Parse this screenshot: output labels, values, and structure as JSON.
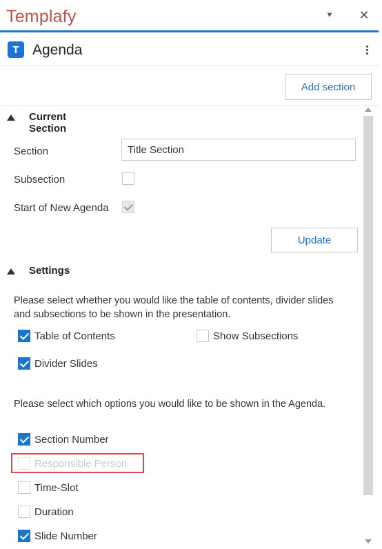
{
  "app": {
    "title": "Templafy"
  },
  "header": {
    "logo_letter": "T",
    "title": "Agenda"
  },
  "toolbar": {
    "add_section_label": "Add section"
  },
  "current_section": {
    "heading": "Current Section",
    "section_label": "Section",
    "section_value": "Title Section",
    "subsection_label": "Subsection",
    "subsection_checked": false,
    "start_label": "Start of New Agenda",
    "start_checked": true,
    "update_label": "Update"
  },
  "settings": {
    "heading": "Settings",
    "intro_text": "Please select whether you would like the table of contents, divider slides and subsections to be shown in the presentation.",
    "toc_label": "Table of Contents",
    "show_subsections_label": "Show Subsections",
    "divider_slides_label": "Divider Slides",
    "options_text": "Please select which options you would like to be shown in the Agenda.",
    "options": [
      {
        "label": "Section Number",
        "checked": true
      },
      {
        "label": "Responsible Person",
        "checked": false,
        "disabled": true
      },
      {
        "label": "Time-Slot",
        "checked": false
      },
      {
        "label": "Duration",
        "checked": false
      },
      {
        "label": "Slide Number",
        "checked": true
      }
    ]
  },
  "colors": {
    "brand": "#c0504d",
    "accent": "#1b75d0",
    "highlight": "#e0474f"
  }
}
